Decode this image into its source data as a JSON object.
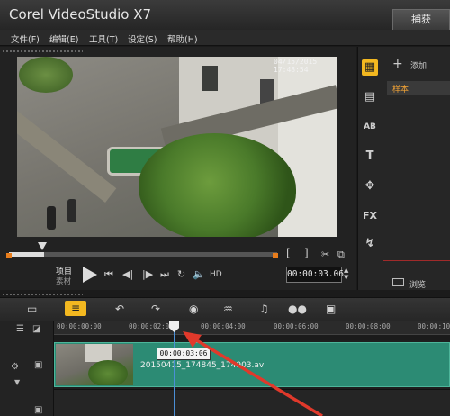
{
  "app": {
    "title": "Corel VideoStudio X7",
    "capture_tab": "捕获"
  },
  "menu": [
    "文件(F)",
    "编辑(E)",
    "工具(T)",
    "设定(S)",
    "帮助(H)"
  ],
  "player": {
    "overlay_timestamp": "04/15/2015  17:48:54",
    "scrub_progress": 0.13,
    "mode_project": "项目",
    "mode_clip": "素材",
    "hd_label": "HD",
    "timecode": "00:00:03.06"
  },
  "library": {
    "add_label": "添加",
    "sample_label": "样本",
    "browse_label": "浏览",
    "icons": [
      "media-icon",
      "instant-project-icon",
      "transition-icon",
      "title-icon",
      "graphic-icon",
      "filter-icon",
      "path-icon"
    ],
    "icon_glyphs": {
      "transition": "AB",
      "title": "T",
      "filter": "FX"
    }
  },
  "timeline": {
    "ruler": [
      "00:00:00:00",
      "00:00:02:00",
      "00:00:04:00",
      "00:00:06:00",
      "00:00:08:00",
      "00:00:10"
    ],
    "playhead_tooltip": "00:00:03:06",
    "clip_name": "20150415_174845_174903.avi"
  },
  "colors": {
    "accent": "#f3b820",
    "clip": "#2c8b74",
    "playhead": "#4b8fd6",
    "arrow": "#e0392b"
  }
}
